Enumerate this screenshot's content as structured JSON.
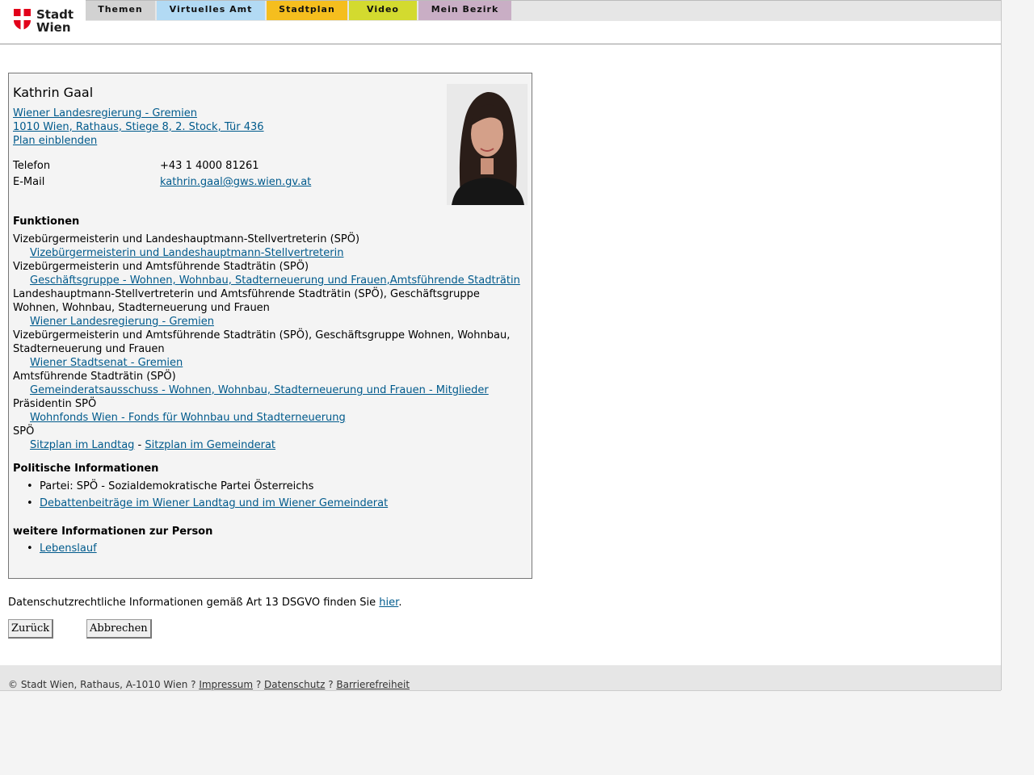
{
  "header": {
    "logo_text_1": "Stadt",
    "logo_text_2": "Wien",
    "nav": [
      {
        "label": "Themen",
        "color": "#d2d2d2"
      },
      {
        "label": "Virtuelles Amt",
        "color": "#b2daf4"
      },
      {
        "label": "Stadtplan",
        "color": "#f5be1e"
      },
      {
        "label": "Video",
        "color": "#d3da2f"
      },
      {
        "label": "Mein Bezirk",
        "color": "#c9aec5"
      }
    ]
  },
  "person": {
    "name": "Kathrin Gaal",
    "org_link": "Wiener Landesregierung - Gremien",
    "address_link": "1010 Wien, Rathaus, Stiege 8, 2. Stock, Tür 436",
    "map_link": "Plan einblenden",
    "phone_label": "Telefon",
    "phone_value": "+43 1 4000 81261",
    "email_label": "E-Mail",
    "email_value": "kathrin.gaal@gws.wien.gv.at"
  },
  "functions": {
    "heading": "Funktionen",
    "f1_text": "Vizebürgermeisterin und Landeshauptmann-Stellvertreterin (SPÖ)",
    "f1_link": "Vizebürgermeisterin und Landeshauptmann-Stellvertreterin",
    "f2_text": "Vizebürgermeisterin und Amtsführende Stadträtin (SPÖ)",
    "f2_link": "Geschäftsgruppe - Wohnen, Wohnbau, Stadterneuerung und Frauen,Amtsführende Stadträtin",
    "f3_text_line1": "Landeshauptmann-Stellvertreterin und Amtsführende Stadträtin (SPÖ), Geschäftsgruppe",
    "f3_text_line2": "Wohnen, Wohnbau, Stadterneuerung und Frauen",
    "f3_link": "Wiener Landesregierung - Gremien",
    "f4_text_line1": "Vizebürgermeisterin und Amtsführende Stadträtin (SPÖ), Geschäftsgruppe Wohnen, Wohnbau,",
    "f4_text_line2": "Stadterneuerung und Frauen",
    "f4_link": "Wiener Stadtsenat - Gremien",
    "f5_text": "Amtsführende Stadträtin (SPÖ)",
    "f5_link": "Gemeinderatsausschuss - Wohnen, Wohnbau, Stadterneuerung und Frauen - Mitglieder",
    "f6_text": "Präsidentin SPÖ",
    "f6_link": "Wohnfonds Wien - Fonds für Wohnbau und Stadterneuerung",
    "f7_text": "SPÖ",
    "f7_link_a": "Sitzplan im Landtag",
    "f7_sep": " - ",
    "f7_link_b": "Sitzplan im Gemeinderat"
  },
  "political": {
    "heading": "Politische Informationen",
    "party": "Partei: SPÖ - Sozialdemokratische Partei Österreichs",
    "debates_link": "Debattenbeiträge im Wiener Landtag und im Wiener Gemeinderat"
  },
  "further": {
    "heading": "weitere Informationen zur Person",
    "cv_link": "Lebenslauf"
  },
  "privacy": {
    "text": "Datenschutzrechtliche Informationen gemäß Art 13 DSGVO finden Sie ",
    "link": "hier",
    "end": "."
  },
  "buttons": {
    "back": "Zurück",
    "cancel": "Abbrechen"
  },
  "footer": {
    "copyright": "© Stadt Wien, Rathaus, A-1010 Wien",
    "sep": " ? ",
    "impressum": "Impressum",
    "datenschutz": "Datenschutz",
    "barrierefreiheit": "Barrierefreiheit"
  }
}
